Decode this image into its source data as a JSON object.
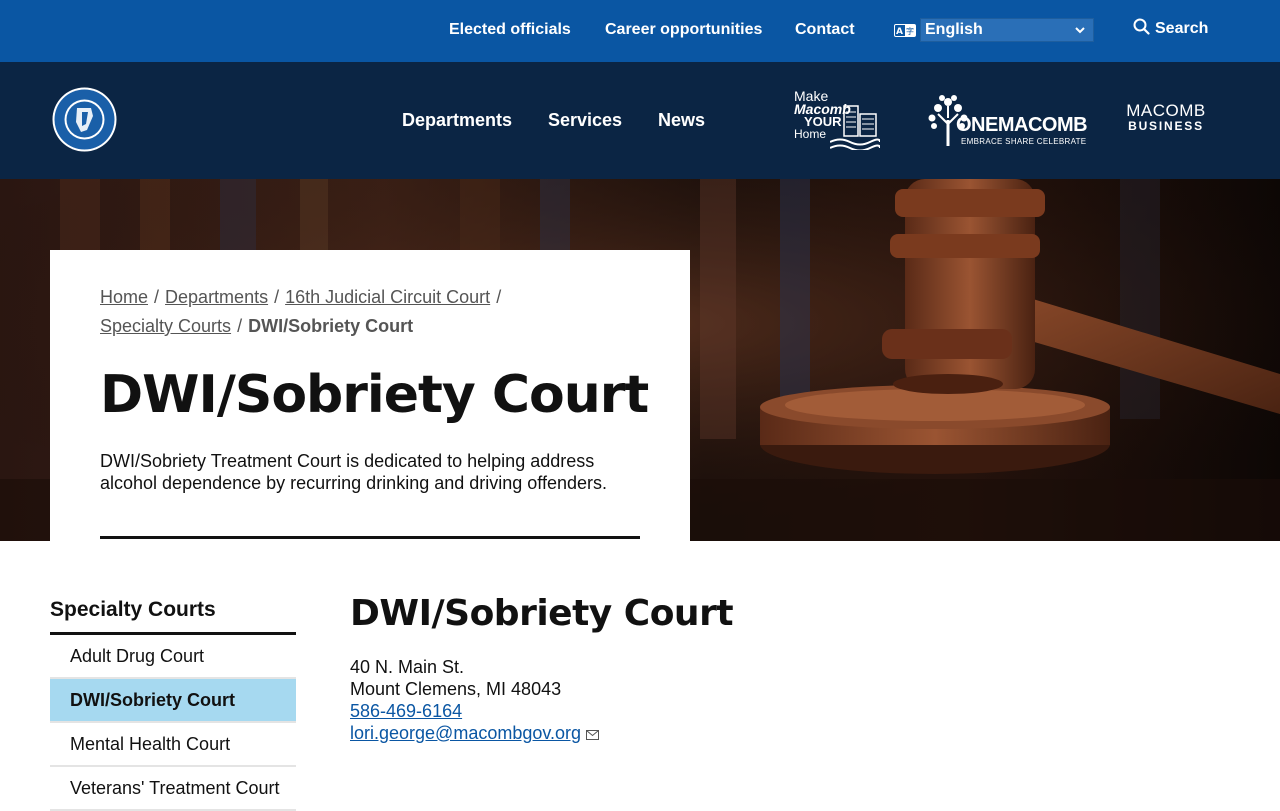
{
  "utility": {
    "elected": "Elected officials",
    "career": "Career opportunities",
    "contact": "Contact",
    "language": "English",
    "search": "Search"
  },
  "nav": {
    "departments": "Departments",
    "services": "Services",
    "news": "News"
  },
  "logos": {
    "seal_text": "MACOMB COUNTY MICHIGAN",
    "make_macomb": [
      "Make",
      "Macomb",
      "YOUR",
      "Home"
    ],
    "onemacomb": "ONEMACOMB",
    "onemacomb_tag": "EMBRACE SHARE CELEBRATE",
    "macomb_business": [
      "MACOMB",
      "BUSINESS"
    ]
  },
  "breadcrumb": {
    "home": "Home",
    "departments": "Departments",
    "circuit": "16th Judicial Circuit Court",
    "specialty": "Specialty Courts",
    "current": "DWI/Sobriety Court",
    "sep": "/"
  },
  "hero": {
    "title": "DWI/Sobriety Court",
    "description": "DWI/Sobriety Treatment Court is dedicated to helping address alcohol dependence by recurring drinking and driving offenders."
  },
  "sidebar": {
    "title": "Specialty Courts",
    "items": [
      {
        "label": "Adult Drug Court"
      },
      {
        "label": "DWI/Sobriety Court"
      },
      {
        "label": "Mental Health Court"
      },
      {
        "label": "Veterans' Treatment Court"
      }
    ]
  },
  "content": {
    "title": "DWI/Sobriety Court",
    "street": "40 N. Main St.",
    "city": "Mount Clemens, MI 48043",
    "phone": "586-469-6164",
    "email": "lori.george@macombgov.org"
  },
  "colors": {
    "utility_bg": "#0a56a3",
    "nav_bg": "#0b2544",
    "active_bg": "#a6d9f0",
    "link": "#0a56a3"
  }
}
